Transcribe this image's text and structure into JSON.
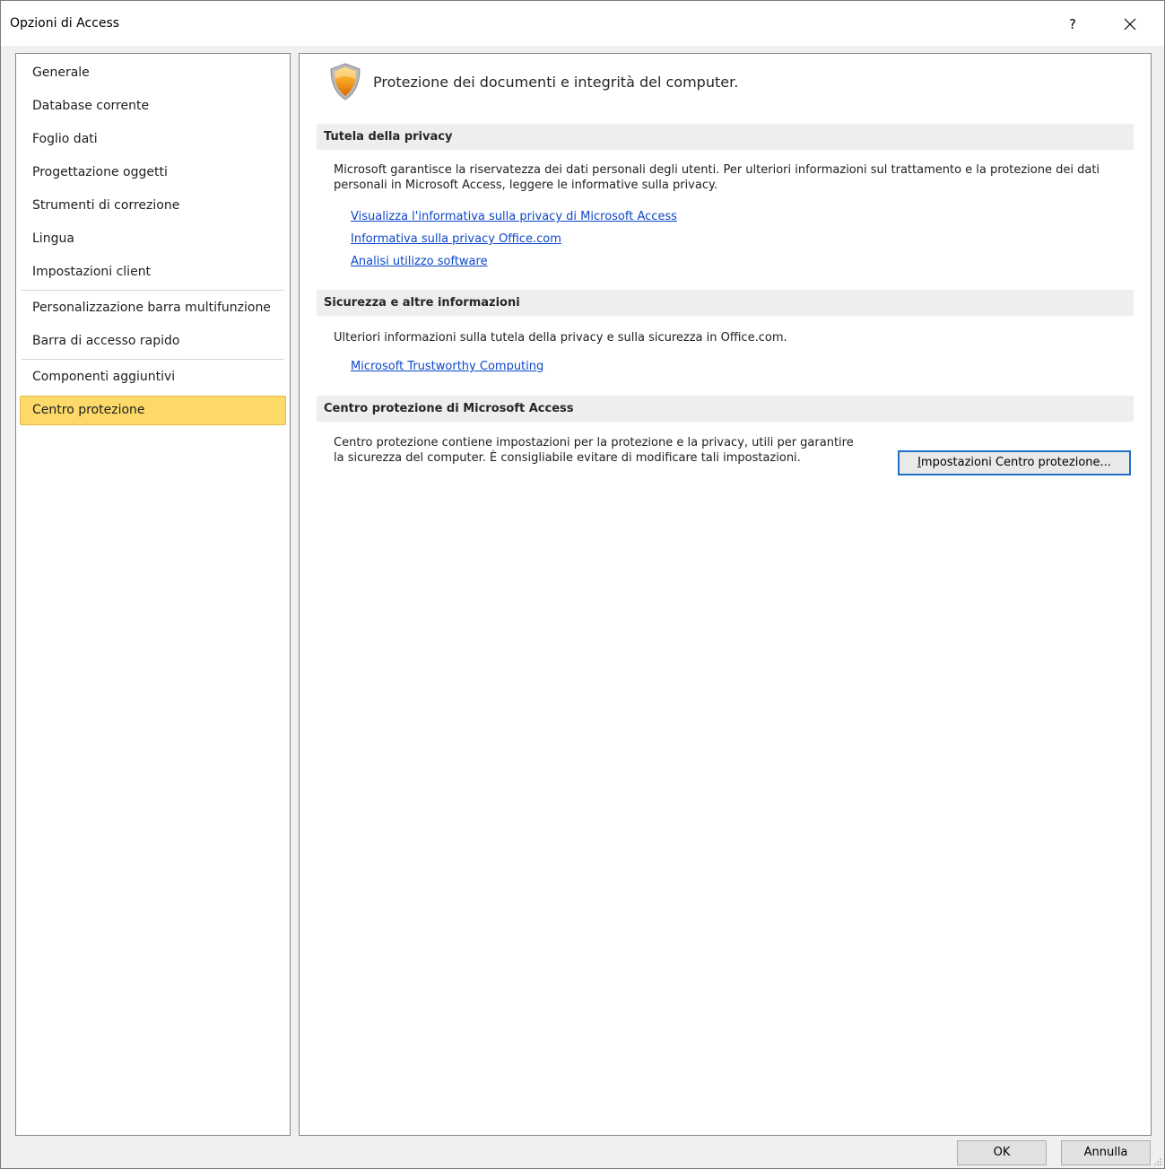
{
  "window": {
    "title": "Opzioni di Access",
    "help_label": "?"
  },
  "sidebar": {
    "items": [
      {
        "label": "Generale"
      },
      {
        "label": "Database corrente"
      },
      {
        "label": "Foglio dati"
      },
      {
        "label": "Progettazione oggetti"
      },
      {
        "label": "Strumenti di correzione"
      },
      {
        "label": "Lingua"
      },
      {
        "label": "Impostazioni client"
      },
      {
        "label": "Personalizzazione barra multifunzione"
      },
      {
        "label": "Barra di accesso rapido"
      },
      {
        "label": "Componenti aggiuntivi"
      },
      {
        "label": "Centro protezione",
        "selected": true
      }
    ]
  },
  "main": {
    "heading": "Protezione dei documenti e integrità del computer.",
    "sections": [
      {
        "title": "Tutela della privacy",
        "text": "Microsoft garantisce la riservatezza dei dati personali degli utenti. Per ulteriori informazioni sul trattamento e la protezione dei dati personali in Microsoft Access, leggere le informative sulla privacy.",
        "links": [
          "Visualizza l'informativa sulla privacy di Microsoft Access",
          "Informativa sulla privacy Office.com",
          "Analisi utilizzo software"
        ]
      },
      {
        "title": "Sicurezza e altre informazioni",
        "text": "Ulteriori informazioni sulla tutela della privacy e sulla sicurezza in Office.com.",
        "links": [
          "Microsoft Trustworthy Computing"
        ]
      },
      {
        "title": "Centro protezione di Microsoft Access",
        "text": "Centro protezione contiene impostazioni per la protezione e la privacy, utili per garantire la sicurezza del computer. È consigliabile evitare di modificare tali impostazioni.",
        "button_label_first": "I",
        "button_label_rest": "mpostazioni Centro protezione..."
      }
    ]
  },
  "footer": {
    "ok_label": "OK",
    "cancel_label": "Annulla"
  },
  "colors": {
    "selected_nav": "#fcd968",
    "link": "#0d47c9",
    "section_header_bg": "#eeeeee"
  }
}
